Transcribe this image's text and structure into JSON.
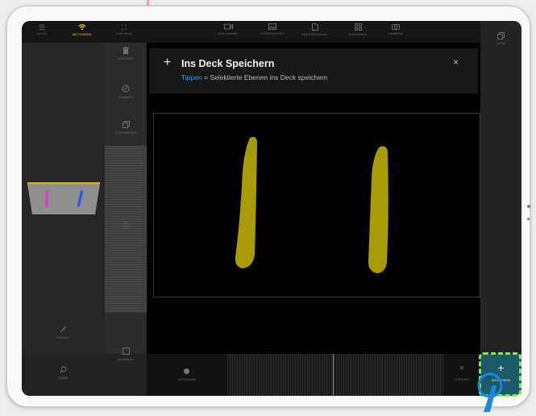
{
  "topbar": {
    "items": [
      {
        "label": "MENÜ",
        "icon": "menu-icon"
      },
      {
        "label": "NETZWERK",
        "icon": "wifi-icon"
      },
      {
        "label": "VOLLBILD",
        "icon": "fullscreen-icon"
      },
      {
        "label": "AUFNAHME",
        "icon": "video-camera-icon"
      },
      {
        "label": "SCREENSHOT",
        "icon": "image-icon"
      },
      {
        "label": "HINTERGRUND",
        "icon": "document-icon"
      },
      {
        "label": "EINGÄNGE",
        "icon": "grid-icon"
      },
      {
        "label": "KAMERA",
        "icon": "camera-icon"
      }
    ],
    "active_color": "#f3d21a"
  },
  "layer_tools": {
    "delete": "LÖSCHEN",
    "separate": "TRENNEN",
    "duplicate": "DUPLIZIEREN"
  },
  "left_bottom": {
    "draw": "MALEN",
    "zoom": "ZOOM",
    "select": "AUSWAHL"
  },
  "right_column": {
    "deck": "DECK"
  },
  "banner": {
    "plus": "+",
    "title": "Ins Deck Speichern",
    "hint_link": "Tippen",
    "hint_rest": " = Selektierte Ebenen ins Deck speichern",
    "close": "×"
  },
  "bottombar": {
    "record": "AUFNAHME",
    "delete_icon": "×",
    "delete": "LÖSCHEN",
    "save_icon": "+",
    "save": "SPEICHERN"
  },
  "colors": {
    "stroke_olive": "#a99a08",
    "thumb_border": "#c7b21a",
    "thumb_magenta": "#e639c8",
    "thumb_blue": "#2d5ee8",
    "link_blue": "#2f9ce8",
    "highlight_green": "#8ee35a",
    "save_bg": "#1a5a6a",
    "touch_blue": "#1e88d8"
  }
}
